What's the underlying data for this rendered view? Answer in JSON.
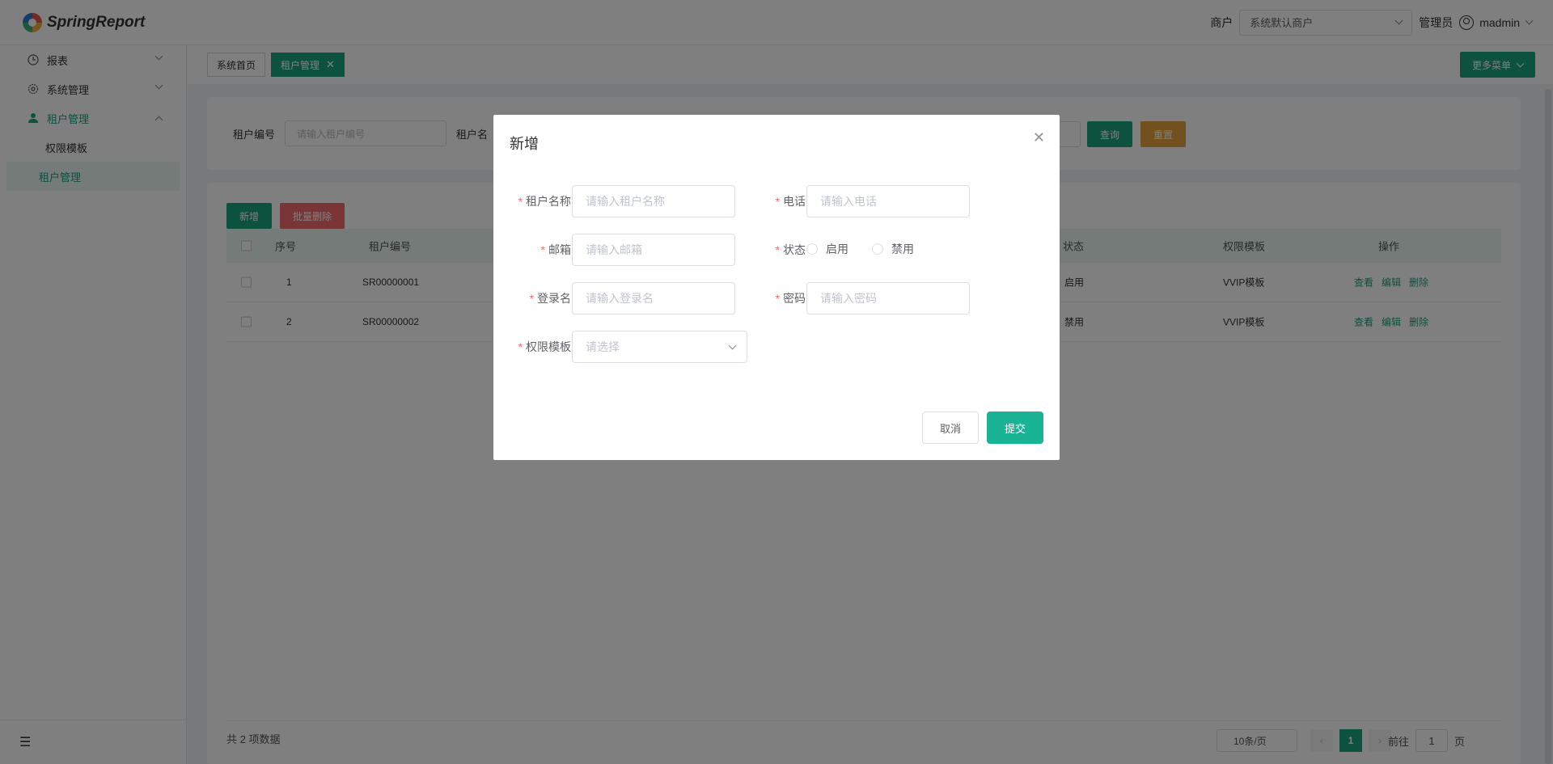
{
  "header": {
    "logo_text": "SpringReport",
    "merchant_label": "商户",
    "merchant_value": "系统默认商户",
    "role": "管理员",
    "username": "madmin"
  },
  "sidebar": {
    "items": [
      {
        "label": "报表",
        "icon": "clock-icon"
      },
      {
        "label": "系统管理",
        "icon": "gear-icon"
      },
      {
        "label": "租户管理",
        "icon": "user-icon"
      }
    ],
    "sub_items": [
      {
        "label": "权限模板"
      },
      {
        "label": "租户管理"
      }
    ]
  },
  "tabs": [
    {
      "label": "系统首页"
    },
    {
      "label": "租户管理"
    }
  ],
  "more_menu": "更多菜单",
  "search": {
    "tenant_code_label": "租户编号",
    "tenant_code_placeholder": "请输入租户编号",
    "tenant_name_label": "租户名",
    "query": "查询",
    "reset": "重置"
  },
  "table": {
    "add": "新增",
    "batch_delete": "批量删除",
    "headers": {
      "index": "序号",
      "code": "租户编号",
      "status": "状态",
      "template": "权限模板",
      "ops": "操作"
    },
    "rows": [
      {
        "index": "1",
        "code": "SR00000001",
        "status": "启用",
        "template": "VVIP模板"
      },
      {
        "index": "2",
        "code": "SR00000002",
        "status": "禁用",
        "template": "VVIP模板"
      }
    ],
    "op_view": "查看",
    "op_edit": "编辑",
    "op_delete": "删除",
    "total": "共 2 项数据",
    "page_size": "10条/页",
    "current_page": "1",
    "goto_prefix": "前往",
    "goto_value": "1",
    "goto_suffix": "页"
  },
  "dialog": {
    "title": "新增",
    "fields": {
      "tenant_name": {
        "label": "租户名称",
        "placeholder": "请输入租户名称"
      },
      "phone": {
        "label": "电话",
        "placeholder": "请输入电话"
      },
      "email": {
        "label": "邮箱",
        "placeholder": "请输入邮箱"
      },
      "status": {
        "label": "状态",
        "option_enable": "启用",
        "option_disable": "禁用"
      },
      "login_name": {
        "label": "登录名",
        "placeholder": "请输入登录名"
      },
      "password": {
        "label": "密码",
        "placeholder": "请输入密码"
      },
      "template": {
        "label": "权限模板",
        "placeholder": "请选择"
      }
    },
    "cancel": "取消",
    "submit": "提交"
  },
  "colors": {
    "primary": "#1aa37f",
    "warning": "#e6a23c",
    "danger": "#f56c6c",
    "submit": "#1ab394"
  }
}
